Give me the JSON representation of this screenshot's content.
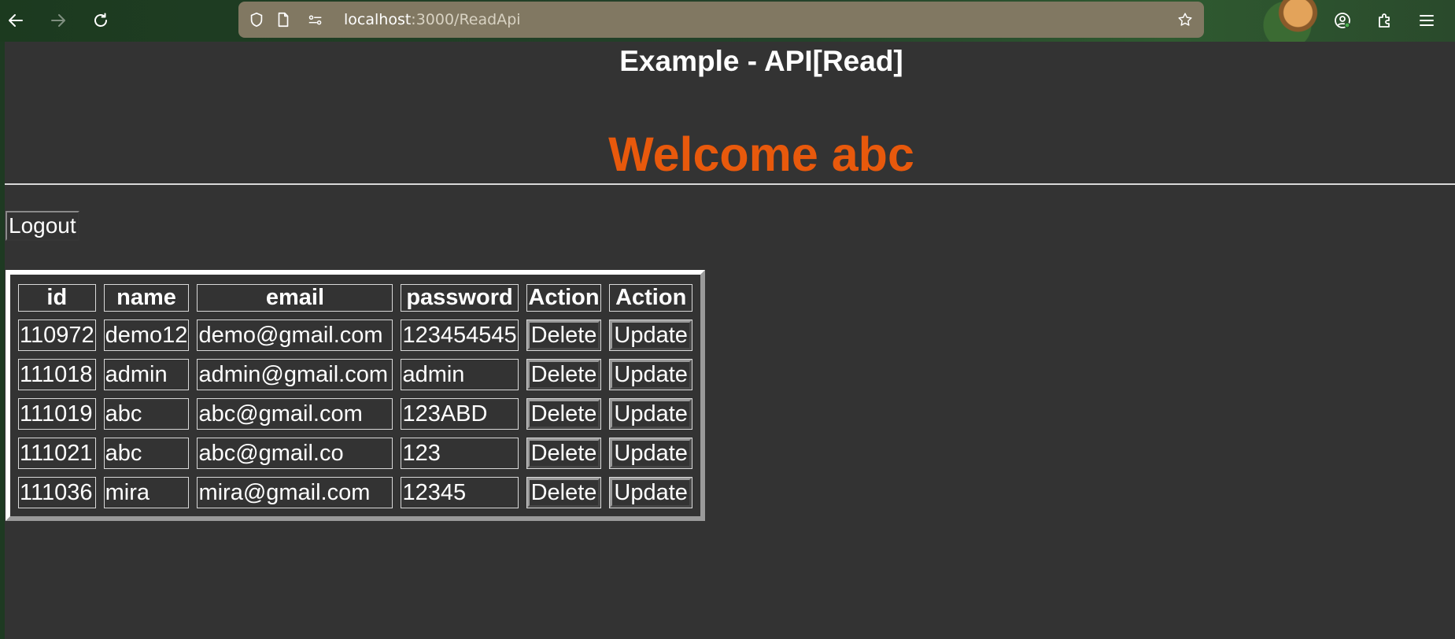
{
  "browser": {
    "url_host": "localhost",
    "url_path": ":3000/ReadApi"
  },
  "page": {
    "title": "Example - API[Read]",
    "welcome": "Welcome abc",
    "logout_label": "Logout"
  },
  "table": {
    "headers": [
      "id",
      "name",
      "email",
      "password",
      "Action",
      "Action"
    ],
    "rows": [
      {
        "id": "110972",
        "name": "demo12",
        "email": "demo@gmail.com",
        "password": "123454545",
        "delete": "Delete",
        "update": "Update"
      },
      {
        "id": "111018",
        "name": "admin",
        "email": "admin@gmail.com",
        "password": "admin",
        "delete": "Delete",
        "update": "Update"
      },
      {
        "id": "111019",
        "name": "abc",
        "email": "abc@gmail.com",
        "password": "123ABD",
        "delete": "Delete",
        "update": "Update"
      },
      {
        "id": "111021",
        "name": "abc",
        "email": "abc@gmail.co",
        "password": "123",
        "delete": "Delete",
        "update": "Update"
      },
      {
        "id": "111036",
        "name": "mira",
        "email": "mira@gmail.com",
        "password": "12345",
        "delete": "Delete",
        "update": "Update"
      }
    ]
  },
  "icons": {
    "back": "arrow-left-icon",
    "forward": "arrow-right-icon",
    "reload": "reload-icon",
    "shield": "shield-icon",
    "page": "page-icon",
    "permissions": "permissions-icon",
    "bookmark": "star-icon",
    "account": "account-icon",
    "extensions": "puzzle-icon",
    "menu": "hamburger-menu-icon"
  },
  "colors": {
    "page_bg": "#333333",
    "welcome": "#e8590c",
    "urlbar": "#817862"
  }
}
